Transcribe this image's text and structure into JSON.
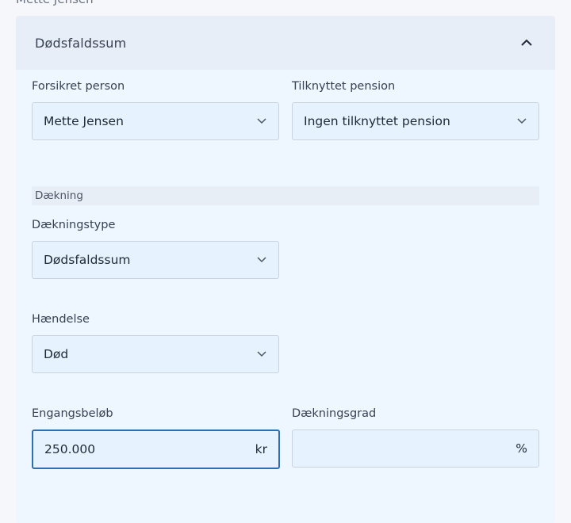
{
  "top_name": "Mette Jensen",
  "panel": {
    "title": "Dødsfaldssum"
  },
  "fields": {
    "insured_person": {
      "label": "Forsikret person",
      "value": "Mette Jensen"
    },
    "linked_pension": {
      "label": "Tilknyttet pension",
      "value": "Ingen tilknyttet pension"
    },
    "coverage_section": "Dækning",
    "coverage_type": {
      "label": "Dækningstype",
      "value": "Dødsfaldssum"
    },
    "event": {
      "label": "Hændelse",
      "value": "Død"
    },
    "lump_sum": {
      "label": "Engangsbeløb",
      "value": "250.000",
      "suffix": "kr"
    },
    "coverage_degree": {
      "label": "Dækningsgrad",
      "value": "",
      "suffix": "%"
    }
  }
}
